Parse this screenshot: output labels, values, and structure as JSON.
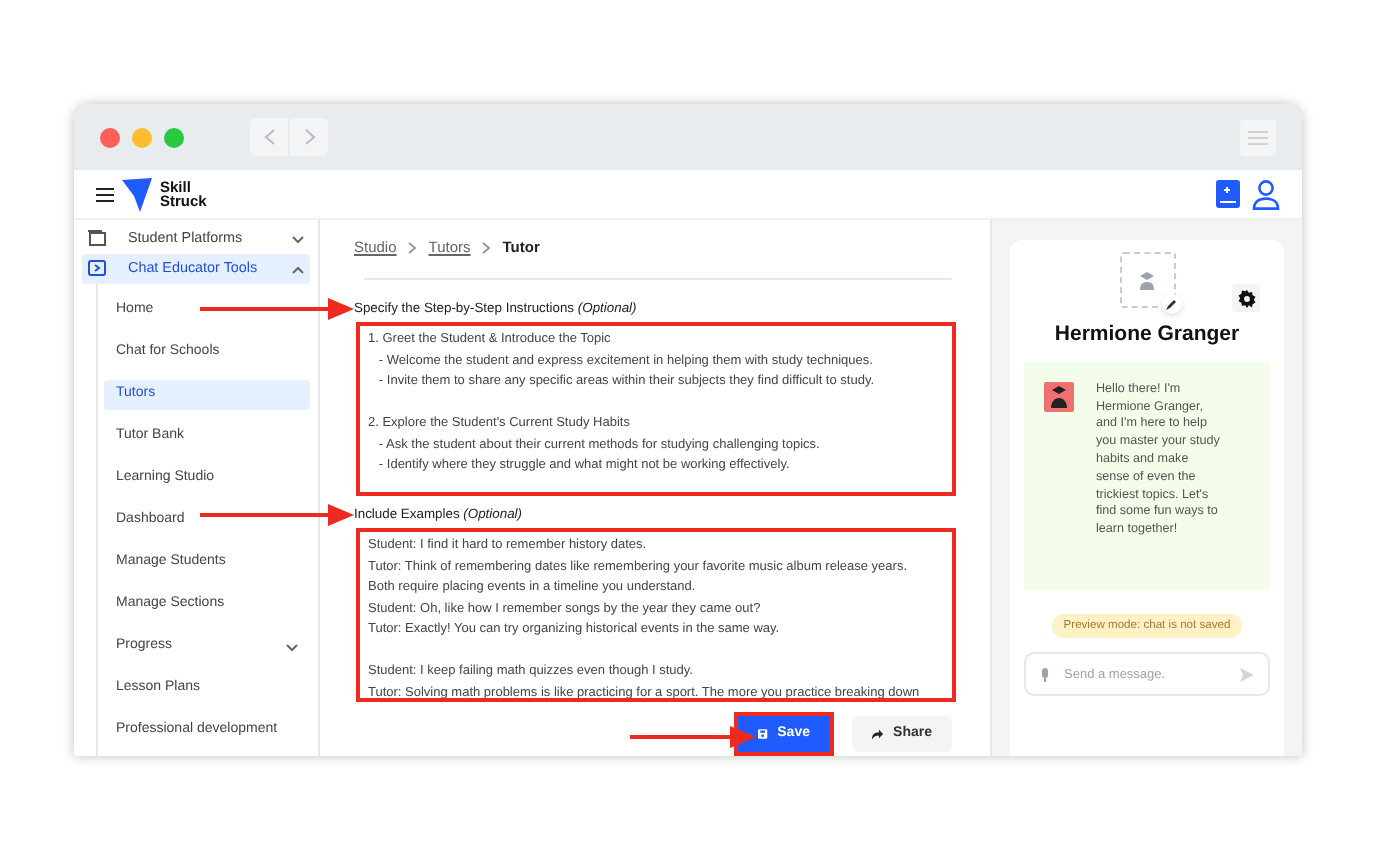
{
  "app": {
    "logo_text": [
      "Skill",
      "Struck"
    ]
  },
  "sidebar": {
    "items": [
      {
        "label": "Student Platforms",
        "expanded": false,
        "selected": false
      },
      {
        "label": "Chat Educator Tools",
        "expanded": true,
        "selected": true,
        "children": [
          {
            "label": "Home",
            "selected": false
          },
          {
            "label": "Chat for Schools",
            "selected": false
          },
          {
            "label": "Tutors",
            "selected": true
          },
          {
            "label": "Tutor Bank",
            "selected": false
          },
          {
            "label": "Learning Studio",
            "selected": false
          },
          {
            "label": "Dashboard",
            "selected": false
          },
          {
            "label": "Manage Students",
            "selected": false
          },
          {
            "label": "Manage Sections",
            "selected": false
          },
          {
            "label": "Progress",
            "selected": false,
            "expandable": true
          },
          {
            "label": "Lesson Plans",
            "selected": false
          },
          {
            "label": "Professional development",
            "selected": false
          }
        ]
      }
    ]
  },
  "breadcrumb": [
    {
      "label": "Studio",
      "link": true
    },
    {
      "label": "Tutors",
      "link": true
    },
    {
      "label": "Tutor",
      "link": false
    }
  ],
  "fields": [
    {
      "label": "Specify the Step-by-Step Instructions *(Optional)*",
      "value": "1. Greet the Student & Introduce the Topic\n   - Welcome the student and express excitement in helping them with study techniques.\n   - Invite them to share any specific areas within their subjects they find difficult to study.\n\n2. Explore the Student's Current Study Habits\n   - Ask the student about their current methods for studying challenging topics.\n   - Identify where they struggle and what might not be working effectively."
    },
    {
      "label": "Include Examples *(Optional)*",
      "value": "Student: I find it hard to remember history dates.\nTutor: Think of remembering dates like remembering your favorite music album release years.\nBoth require placing events in a timeline you understand.\nStudent: Oh, like how I remember songs by the year they came out?\nTutor: Exactly! You can try organizing historical events in the same way.\n\nStudent: I keep failing math quizzes even though I study.\nTutor: Solving math problems is like practicing for a sport. The more you practice breaking down"
    }
  ],
  "buttons": [
    {
      "label": "Save",
      "kind": "primary"
    },
    {
      "label": "Share",
      "kind": "secondary"
    }
  ],
  "preview": {
    "name": "Hermione Granger",
    "message": "Hello there! I'm Hermione Granger, and I'm here to help you master your study habits and make sense of even the trickiest topics. Let's find some fun ways to learn together!",
    "notice": "Preview mode: chat is not saved",
    "input_placeholder": "Send a message."
  }
}
